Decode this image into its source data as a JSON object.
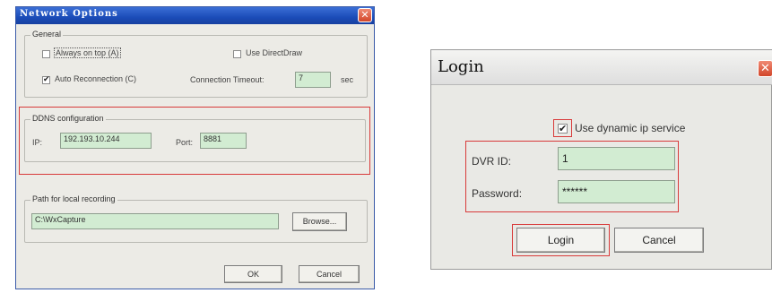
{
  "network_options": {
    "title": "Network Options",
    "general": {
      "legend": "General",
      "always_on_top": {
        "label": "Always on top (A)",
        "checked": false
      },
      "use_directdraw": {
        "label": "Use DirectDraw",
        "checked": false
      },
      "auto_reconnection": {
        "label": "Auto Reconnection (C)",
        "checked": true
      },
      "connection_timeout_label": "Connection Timeout:",
      "connection_timeout_value": "7",
      "connection_timeout_unit": "sec"
    },
    "ddns": {
      "legend": "DDNS configuration",
      "ip_label": "IP:",
      "ip_value": "192.193.10.244",
      "port_label": "Port:",
      "port_value": "8881"
    },
    "recording": {
      "legend": "Path for local recording",
      "path_value": "C:\\WxCapture",
      "browse_label": "Browse..."
    },
    "ok_label": "OK",
    "cancel_label": "Cancel"
  },
  "login": {
    "title": "Login",
    "dynamic_ip": {
      "label": "Use dynamic ip service",
      "checked": true
    },
    "dvr_id_label": "DVR ID:",
    "dvr_id_value": "1",
    "password_label": "Password:",
    "password_value": "******",
    "login_label": "Login",
    "cancel_label": "Cancel"
  },
  "colors": {
    "highlight": "#d83a3a",
    "field_bg": "#d2ecd2",
    "titlebar_blue": "#1b4cb8",
    "close_red": "#d2462a"
  }
}
